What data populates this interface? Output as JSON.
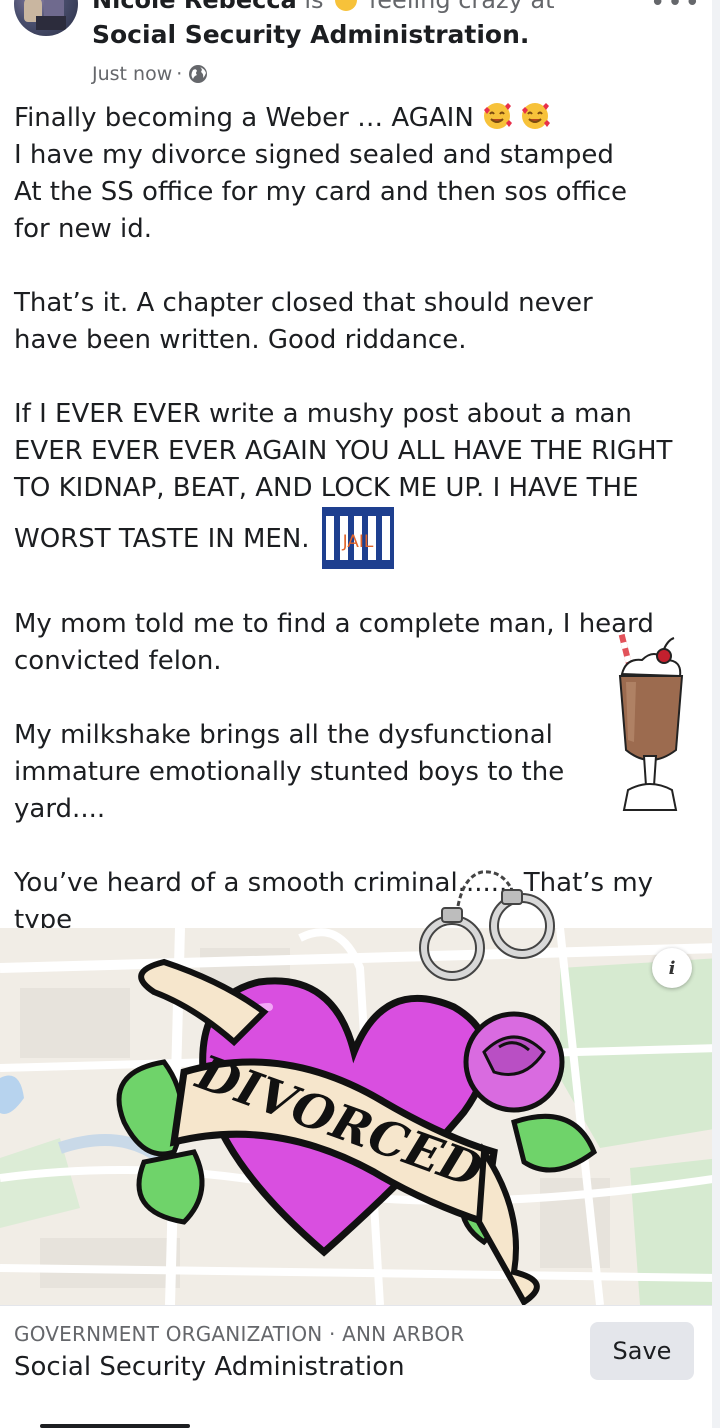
{
  "header": {
    "author_name": "Nicole Rebecca",
    "feeling_prefix": "is",
    "feeling_text": "feeling crazy at",
    "location": "Social Security Administration.",
    "timestamp": "Just now",
    "meta_separator": "·",
    "privacy_icon": "globe-icon",
    "more_icon": "more-horizontal-icon"
  },
  "post": {
    "lines": {
      "l1": "Finally becoming a Weber … AGAIN",
      "l2": "I have my divorce signed sealed and stamped",
      "l3": "At the SS office for my card and then sos office",
      "l4": "for new id.",
      "l5": "That’s it. A chapter closed that should never",
      "l6": "have been written. Good riddance.",
      "l7": "If I EVER EVER write a mushy post about a man",
      "l8": "EVER EVER EVER AGAIN YOU ALL HAVE THE RIGHT",
      "l9": "TO KIDNAP, BEAT, AND LOCK ME UP. I HAVE THE",
      "l10": "WORST TASTE IN MEN.",
      "l11": "My mom told me to find a complete man, I heard",
      "l12": "convicted felon.",
      "l13": "My milkshake brings all the dysfunctional",
      "l14": "immature emotionally stunted boys to the",
      "l15": "yard....",
      "l16": "You’ve heard of a smooth criminal....... That’s my",
      "l17": "type"
    },
    "emojis": [
      "smiling-face-with-hearts-emoji",
      "smiling-face-with-hearts-emoji"
    ]
  },
  "stickers": {
    "jail_text": "JAIL",
    "divorced_text": "DIVORCED",
    "milkshake_icon": "milkshake-sticker",
    "handcuffs_icon": "handcuffs-sticker"
  },
  "map": {
    "info_label": "i"
  },
  "place": {
    "category": "GOVERNMENT ORGANIZATION · ANN ARBOR",
    "name": "Social Security Administration",
    "save_label": "Save"
  },
  "colors": {
    "text": "#1c1e21",
    "muted": "#65676b",
    "button_bg": "#e4e6eb",
    "heart": "#d94fe0",
    "banner": "#f6e6cc",
    "leaf": "#6fd36a",
    "map_bg": "#f1ede6"
  }
}
